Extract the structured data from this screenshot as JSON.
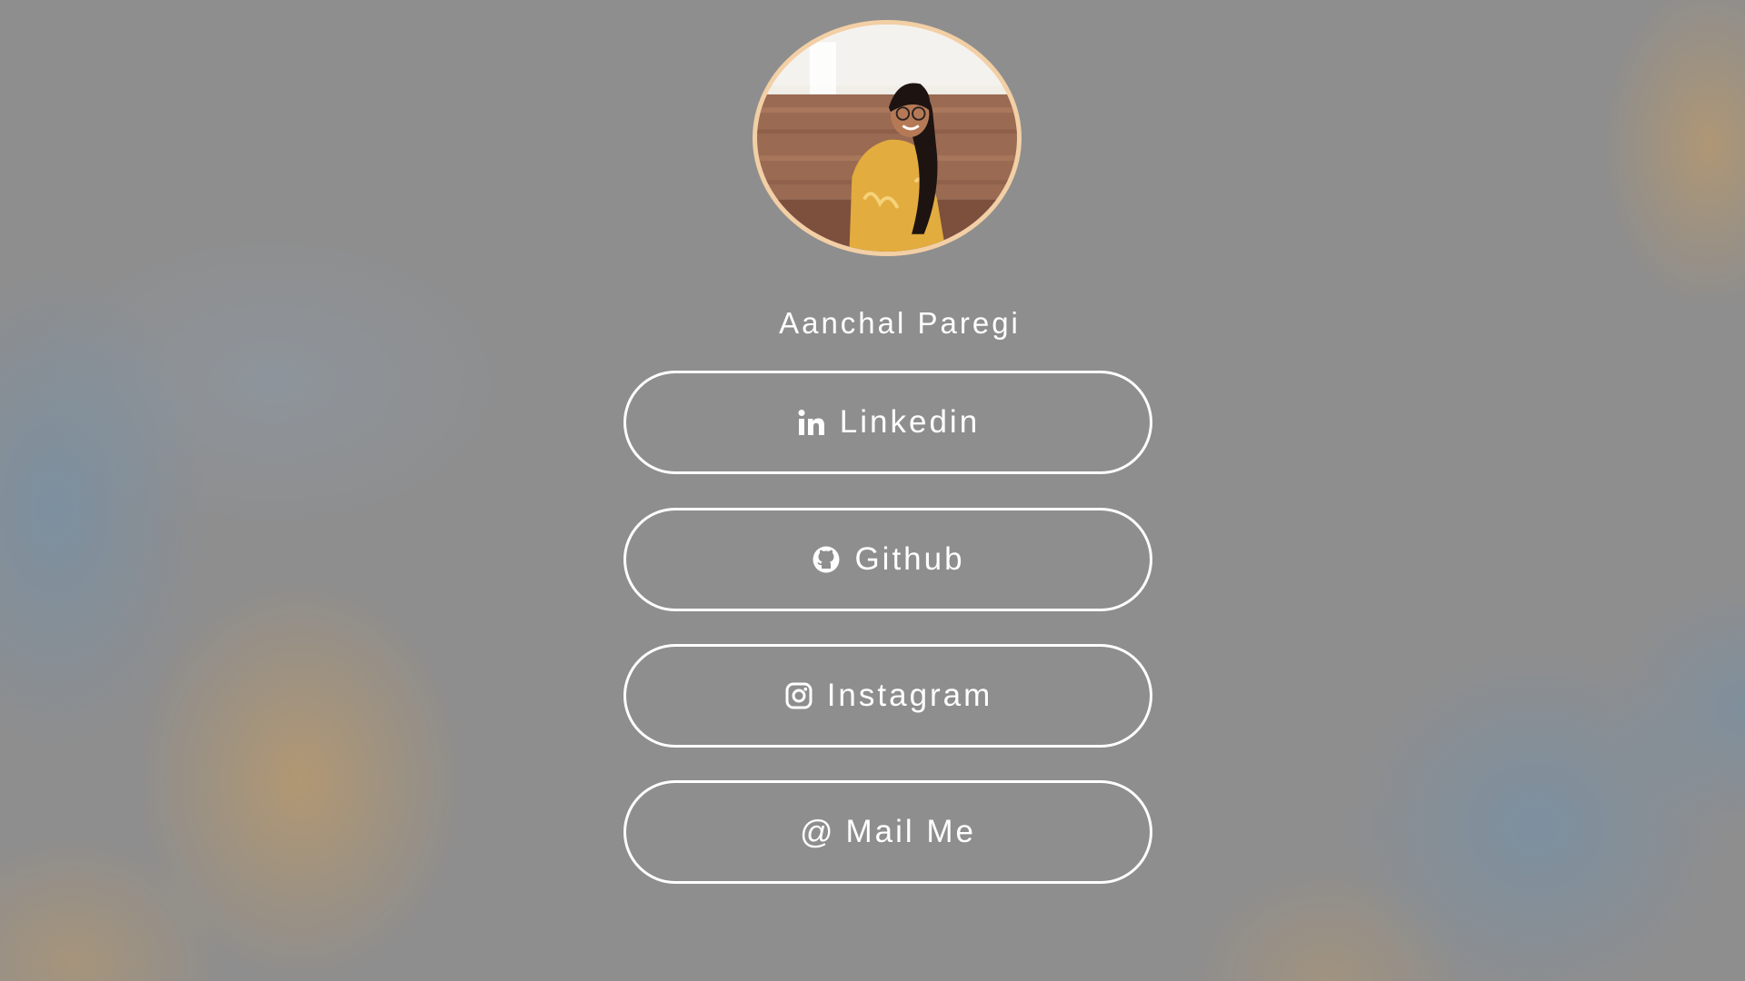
{
  "profile": {
    "name": "Aanchal Paregi",
    "avatar_icon": "profile-photo"
  },
  "links": [
    {
      "label": "Linkedin",
      "icon": "linkedin-icon"
    },
    {
      "label": "Github",
      "icon": "github-icon"
    },
    {
      "label": "Instagram",
      "icon": "instagram-icon"
    },
    {
      "label": "Mail Me",
      "icon": "at-sign-icon",
      "icon_glyph": "@"
    }
  ],
  "colors": {
    "background": "#8e8e8e",
    "avatar_border": "#f3cfa5",
    "text": "#ffffff",
    "button_border": "#ffffff"
  }
}
